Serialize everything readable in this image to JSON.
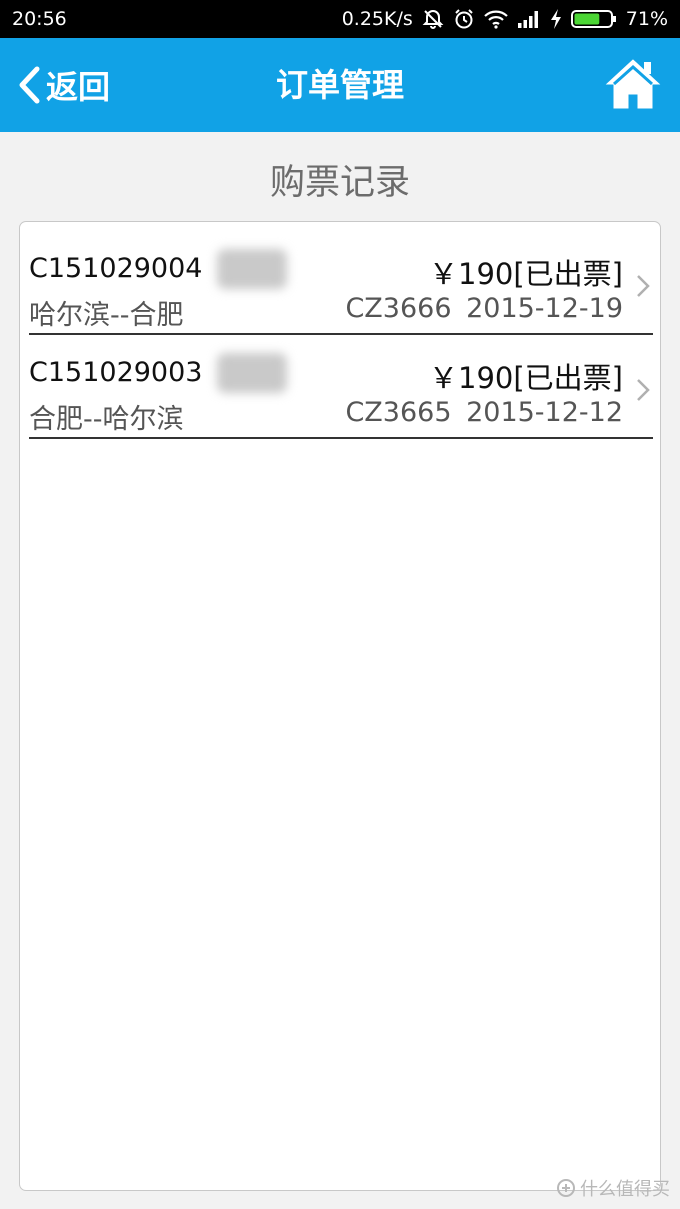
{
  "status_bar": {
    "time": "20:56",
    "speed": "0.25K/s",
    "battery": "71%",
    "battery_level": 0.71,
    "icons": [
      "mute-icon",
      "alarm-icon",
      "wifi-icon",
      "signal-icon",
      "charging-icon",
      "battery-icon"
    ]
  },
  "nav": {
    "back_label": "返回",
    "title": "订单管理",
    "home_icon": "home-icon"
  },
  "section_title": "购票记录",
  "orders": [
    {
      "order_no": "C151029004",
      "price_status": "￥190[已出票]",
      "route": "哈尔滨--合肥",
      "flight_date": "CZ3666 2015-12-19"
    },
    {
      "order_no": "C151029003",
      "price_status": "￥190[已出票]",
      "route": "合肥--哈尔滨",
      "flight_date": "CZ3665 2015-12-12"
    }
  ],
  "watermark": "什么值得买",
  "colors": {
    "nav_bg": "#11a2e6",
    "battery": "#4cd635"
  }
}
